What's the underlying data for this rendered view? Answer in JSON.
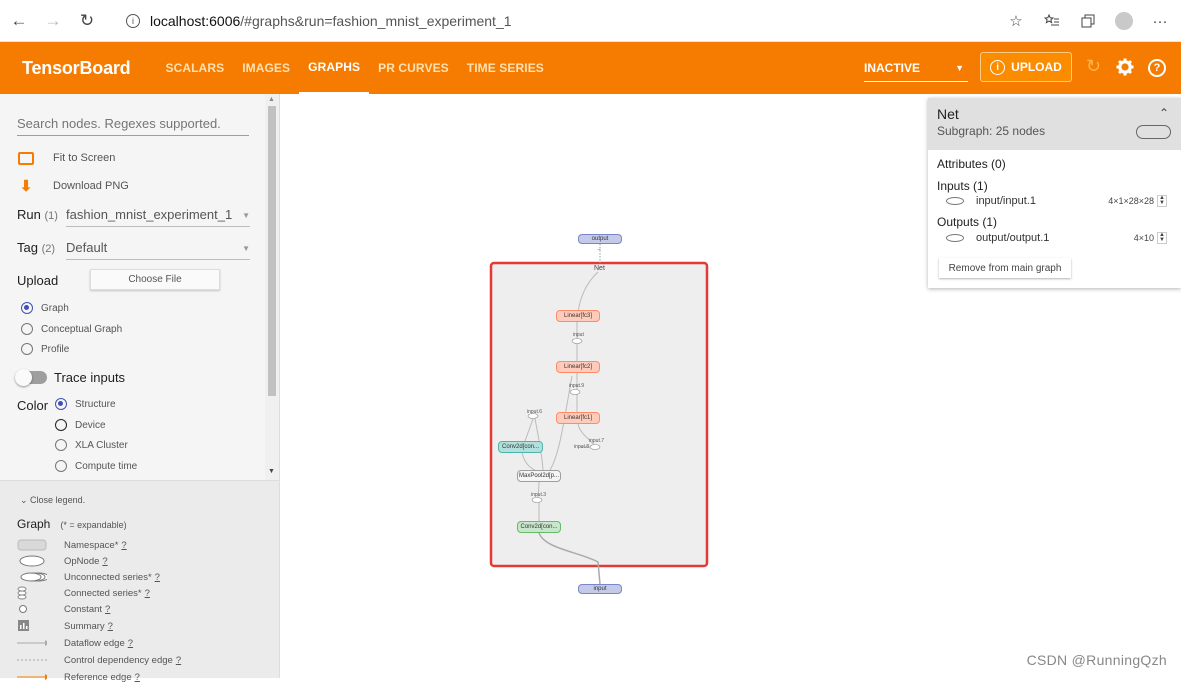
{
  "browser": {
    "url_host": "localhost:6006",
    "url_rest": "/#graphs&run=fashion_mnist_experiment_1",
    "icons": [
      "back-icon",
      "forward-icon",
      "refresh-icon",
      "info-icon",
      "star-icon",
      "favorites-icon",
      "collections-icon",
      "profile-icon",
      "more-icon"
    ]
  },
  "toolbar": {
    "title": "TensorBoard",
    "tabs": [
      {
        "label": "SCALARS",
        "active": false
      },
      {
        "label": "IMAGES",
        "active": false
      },
      {
        "label": "GRAPHS",
        "active": true
      },
      {
        "label": "PR CURVES",
        "active": false
      },
      {
        "label": "TIME SERIES",
        "active": false
      }
    ],
    "inactive_label": "INACTIVE",
    "upload_label": "UPLOAD",
    "accent_color": "#f57c00"
  },
  "sidebar": {
    "search_placeholder": "Search nodes. Regexes supported.",
    "fit_label": "Fit to Screen",
    "download_label": "Download PNG",
    "run_label": "Run",
    "run_count": "(1)",
    "run_value": "fashion_mnist_experiment_1",
    "tag_label": "Tag",
    "tag_count": "(2)",
    "tag_value": "Default",
    "upload_label": "Upload",
    "choose_file": "Choose File",
    "graph_types": [
      "Graph",
      "Conceptual Graph",
      "Profile"
    ],
    "trace_inputs": "Trace inputs",
    "color_label": "Color",
    "color_options": [
      "Structure",
      "Device",
      "XLA Cluster",
      "Compute time"
    ]
  },
  "legend": {
    "toggle": "Close legend.",
    "title": "Graph",
    "subtitle": "(* = expandable)",
    "items": [
      {
        "label": "Namespace*",
        "q": "?"
      },
      {
        "label": "OpNode",
        "q": "?"
      },
      {
        "label": "Unconnected series*",
        "q": "?"
      },
      {
        "label": "Connected series*",
        "q": "?"
      },
      {
        "label": "Constant",
        "q": "?"
      },
      {
        "label": "Summary",
        "q": "?"
      },
      {
        "label": "Dataflow edge",
        "q": "?"
      },
      {
        "label": "Control dependency edge",
        "q": "?"
      },
      {
        "label": "Reference edge",
        "q": "?"
      }
    ]
  },
  "graph": {
    "output_node": "output",
    "net_label": "Net",
    "linear3": "Linear[fc3]",
    "linear2": "Linear[fc2]",
    "linear1": "Linear[fc1]",
    "conv_cyan": "Conv2d[con...",
    "maxpool": "MaxPool2d[p...",
    "conv_green": "Conv2d[con...",
    "input_node": "input",
    "edge_labels": [
      "input",
      "input.9",
      "input.6",
      "input.7",
      "input.8",
      "input.3"
    ],
    "ellipsis_dots": "···"
  },
  "info": {
    "title": "Net",
    "subtitle": "Subgraph: 25 nodes",
    "attributes": "Attributes (0)",
    "inputs_label": "Inputs (1)",
    "input_name": "input/input.1",
    "input_shape": "4×1×28×28",
    "outputs_label": "Outputs (1)",
    "output_name": "output/output.1",
    "output_shape": "4×10",
    "remove_button": "Remove from main graph"
  },
  "watermark": "CSDN @RunningQzh"
}
